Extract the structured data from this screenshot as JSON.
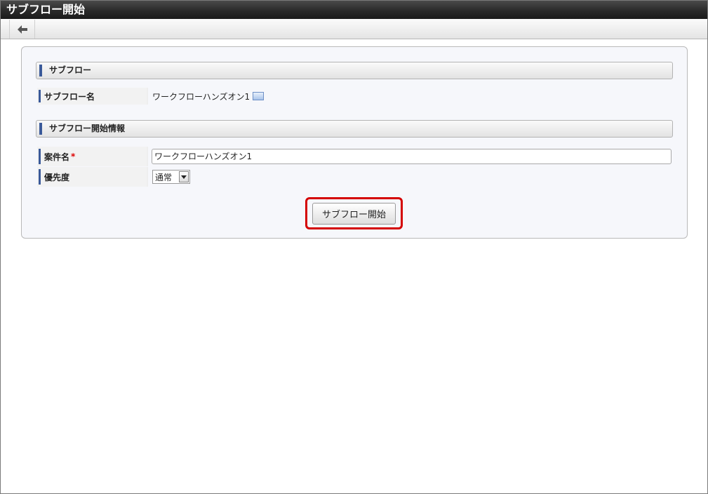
{
  "window": {
    "title": "サブフロー開始"
  },
  "toolbar": {
    "back_icon": "arrow-left-icon"
  },
  "sections": {
    "subflow": {
      "header": "サブフロー",
      "name_label": "サブフロー名",
      "name_value": "ワークフローハンズオン1",
      "name_icon": "document-icon"
    },
    "start_info": {
      "header": "サブフロー開始情報",
      "matter_label": "案件名",
      "required_mark": "*",
      "matter_value": "ワークフローハンズオン1",
      "priority_label": "優先度",
      "priority_value": "通常"
    }
  },
  "actions": {
    "start_label": "サブフロー開始"
  },
  "colors": {
    "accent": "#3a5a9a",
    "highlight": "#d40000"
  }
}
